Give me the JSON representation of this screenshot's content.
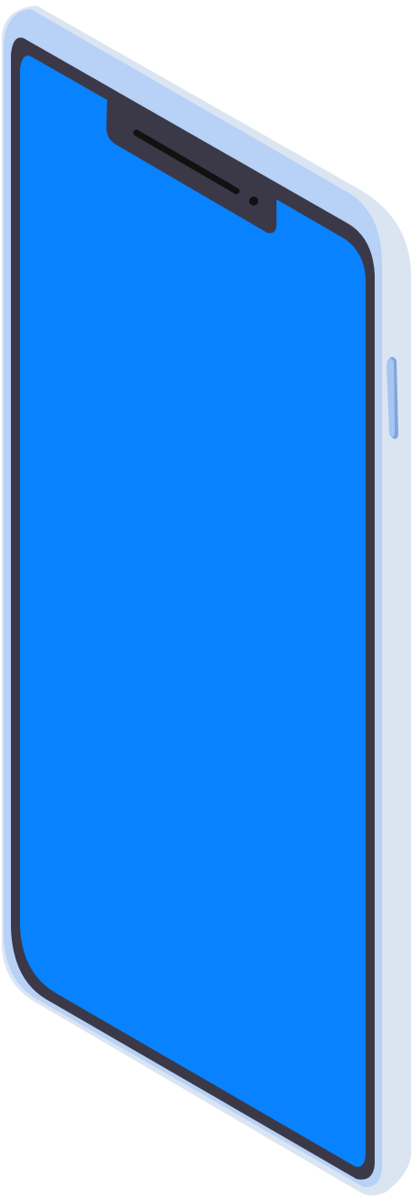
{
  "illustration": {
    "subject": "phone-mockup",
    "colors": {
      "case_back": "#dbe5f2",
      "case_front": "#b8d1f6",
      "case_highlight": "#c9dbf5",
      "bezel": "#3b3948",
      "screen": "#0882fe",
      "notch": "#3b3948",
      "speaker": "#111111",
      "camera": "#111111",
      "side_button": "#a7c5f2",
      "side_button_edge": "#7fa6df"
    },
    "icons": [
      "speaker-grille-icon",
      "front-camera-icon",
      "side-button-icon"
    ]
  }
}
